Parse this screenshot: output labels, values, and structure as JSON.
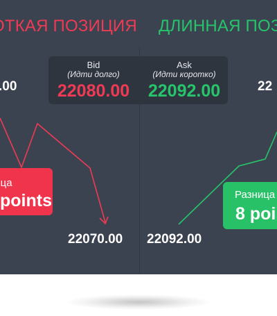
{
  "headings": {
    "short_position": "ОТКАЯ ПОЗИЦИЯ",
    "long_position": "ДЛИННАЯ ПОЗИ"
  },
  "quote": {
    "bid_title": "Bid",
    "bid_subtitle": "(Идти долго)",
    "bid_price": "22080.00",
    "ask_title": "Ask",
    "ask_subtitle": "(Идти коротко)",
    "ask_price": "22092.00"
  },
  "prices": {
    "short_entry_partial": ".00",
    "short_exit": "22070.00",
    "long_entry": "22092.00",
    "long_exit_partial": "22"
  },
  "callouts": {
    "short": {
      "label": "ница",
      "value": "points"
    },
    "long": {
      "label": "Разница",
      "value": "8 poi"
    }
  },
  "colors": {
    "panel_bg": "#3c4350",
    "short_red": "#ee3b55",
    "long_green": "#26c46b",
    "quote_box_bg": "#2f353f"
  }
}
